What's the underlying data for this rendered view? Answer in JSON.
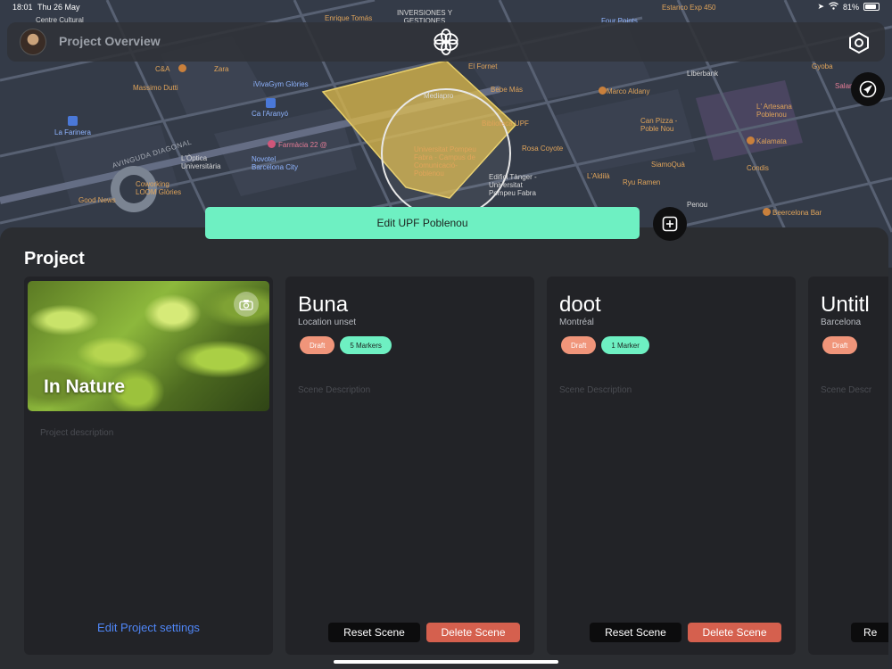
{
  "status_bar": {
    "time": "18:01",
    "date": "Thu 26 May",
    "battery": "81%"
  },
  "header": {
    "title": "Project Overview",
    "avatar": "user-avatar",
    "logo": "flower-logo-icon",
    "settings_icon": "hexagon-settings-icon"
  },
  "map": {
    "labels": [
      {
        "text": "Centre Cultural",
        "color": "white"
      },
      {
        "text": "Enrique Tomás",
        "color": "orange"
      },
      {
        "text": "INVERSIONES Y GESTIONES",
        "color": "white"
      },
      {
        "text": "Four Points",
        "color": "blue"
      },
      {
        "text": "Estanco Exp 450",
        "color": "orange"
      },
      {
        "text": "C&A",
        "color": "orange"
      },
      {
        "text": "Zara",
        "color": "orange"
      },
      {
        "text": "El Fornet",
        "color": "orange"
      },
      {
        "text": "Liberbank",
        "color": "white"
      },
      {
        "text": "Gyoba",
        "color": "orange"
      },
      {
        "text": "Massimo Dutti",
        "color": "orange"
      },
      {
        "text": "iVivaGym Glòries",
        "color": "blue"
      },
      {
        "text": "Bebe Más",
        "color": "orange"
      },
      {
        "text": "Marco Aldany",
        "color": "orange"
      },
      {
        "text": "Mediapro",
        "color": "white"
      },
      {
        "text": "Ca l'Aranyó",
        "color": "blue"
      },
      {
        "text": "Biblioteca UPF",
        "color": "orange"
      },
      {
        "text": "Can Pizza - Poble Nou",
        "color": "orange"
      },
      {
        "text": "L' Artesana Poblenou",
        "color": "orange"
      },
      {
        "text": "La Farinera",
        "color": "blue"
      },
      {
        "text": "Farmàcia 22 @",
        "color": "pink"
      },
      {
        "text": "Kalamata",
        "color": "orange"
      },
      {
        "text": "Universitat Pompeu Fabra - Campus de Comunicació-Poblenou",
        "color": "orange"
      },
      {
        "text": "Rosa Coyote",
        "color": "orange"
      },
      {
        "text": "L'Òptica Universitària",
        "color": "white"
      },
      {
        "text": "Novotel Barcelona City",
        "color": "blue"
      },
      {
        "text": "SiamoQuà",
        "color": "orange"
      },
      {
        "text": "Condis",
        "color": "orange"
      },
      {
        "text": "L'Aldilà",
        "color": "orange"
      },
      {
        "text": "Edifici Tànger - Universitat Pompeu Fabra",
        "color": "white"
      },
      {
        "text": "Coworking LOOM Glòries",
        "color": "orange"
      },
      {
        "text": "Ryu Ramen",
        "color": "orange"
      },
      {
        "text": "Good News",
        "color": "orange"
      },
      {
        "text": "Penou",
        "color": "white"
      },
      {
        "text": "Beercelona Bar",
        "color": "orange"
      },
      {
        "text": "AVINGUDA DIAGONAL",
        "color": "street"
      },
      {
        "text": "Salamanca",
        "color": "pink"
      }
    ],
    "area_color": "#d8b64a"
  },
  "edit_area_button": "Edit UPF Poblenou",
  "sheet": {
    "title": "Project",
    "project": {
      "name": "In Nature",
      "description_placeholder": "Project description",
      "edit_link": "Edit Project settings"
    },
    "scenes": [
      {
        "title": "Buna",
        "location": "Location unset",
        "status": "Draft",
        "markers": "5 Markers",
        "description_placeholder": "Scene Description",
        "reset_label": "Reset Scene",
        "delete_label": "Delete Scene"
      },
      {
        "title": "doot",
        "location": "Montréal",
        "status": "Draft",
        "markers": "1 Marker",
        "description_placeholder": "Scene Description",
        "reset_label": "Reset Scene",
        "delete_label": "Delete Scene"
      },
      {
        "title": "Untitl",
        "location": "Barcelona",
        "status": "Draft",
        "markers": "",
        "description_placeholder": "Scene Descr",
        "reset_label": "Re",
        "delete_label": ""
      }
    ]
  },
  "colors": {
    "accent": "#6ef0c2",
    "danger": "#d5604e",
    "draft": "#f0957a",
    "link": "#4f86f7"
  }
}
